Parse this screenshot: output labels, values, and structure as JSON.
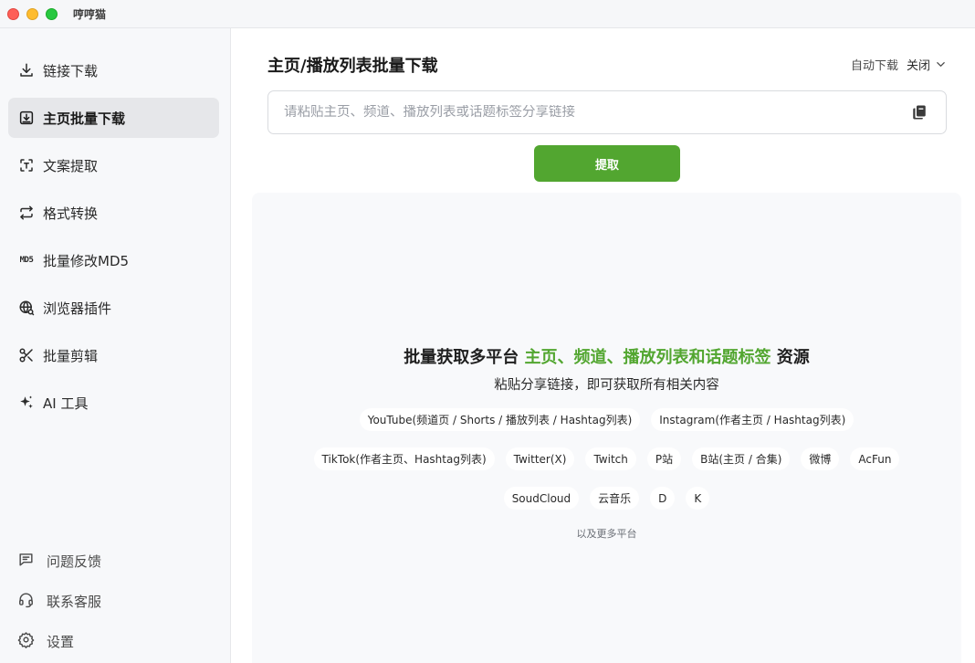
{
  "window": {
    "title": "哼哼猫"
  },
  "sidebar": {
    "items": [
      {
        "label": "链接下载",
        "icon": "download-icon",
        "active": false
      },
      {
        "label": "主页批量下载",
        "icon": "tray-download-icon",
        "active": true
      },
      {
        "label": "文案提取",
        "icon": "scan-text-icon",
        "active": false
      },
      {
        "label": "格式转换",
        "icon": "convert-arrows-icon",
        "active": false
      },
      {
        "label": "批量修改MD5",
        "icon": "md5-icon",
        "icon_text": "MD5",
        "active": false
      },
      {
        "label": "浏览器插件",
        "icon": "globe-icon",
        "active": false
      },
      {
        "label": "批量剪辑",
        "icon": "scissors-icon",
        "active": false
      },
      {
        "label": "AI 工具",
        "icon": "sparkle-icon",
        "active": false
      }
    ],
    "bottom": [
      {
        "label": "问题反馈",
        "icon": "feedback-icon"
      },
      {
        "label": "联系客服",
        "icon": "headset-icon"
      },
      {
        "label": "设置",
        "icon": "gear-icon"
      }
    ]
  },
  "main": {
    "title": "主页/播放列表批量下载",
    "auto_download": {
      "label": "自动下载",
      "value": "关闭"
    },
    "link_input": {
      "placeholder": "请粘贴主页、频道、播放列表或话题标签分享链接",
      "value": ""
    },
    "extract_button": "提取",
    "panel": {
      "headline_prefix": "批量获取多平台 ",
      "headline_highlight": "主页、频道、播放列表和话题标签",
      "headline_suffix": " 资源",
      "subline": "粘贴分享链接，即可获取所有相关内容",
      "platform_rows": [
        [
          "YouTube(频道页 / Shorts / 播放列表 / Hashtag列表)",
          "Instagram(作者主页 / Hashtag列表)"
        ],
        [
          "TikTok(作者主页、Hashtag列表)",
          "Twitter(X)",
          "Twitch",
          "P站",
          "B站(主页 / 合集)",
          "微博",
          "AcFun"
        ],
        [
          "SoudCloud",
          "云音乐",
          "D",
          "K"
        ]
      ],
      "more": "以及更多平台"
    }
  },
  "colors": {
    "accent": "#52a630",
    "active_nav_bg": "#e6e7ea",
    "sidebar_bg": "#f7f8fa",
    "panel_bg": "#f8f9fb"
  }
}
